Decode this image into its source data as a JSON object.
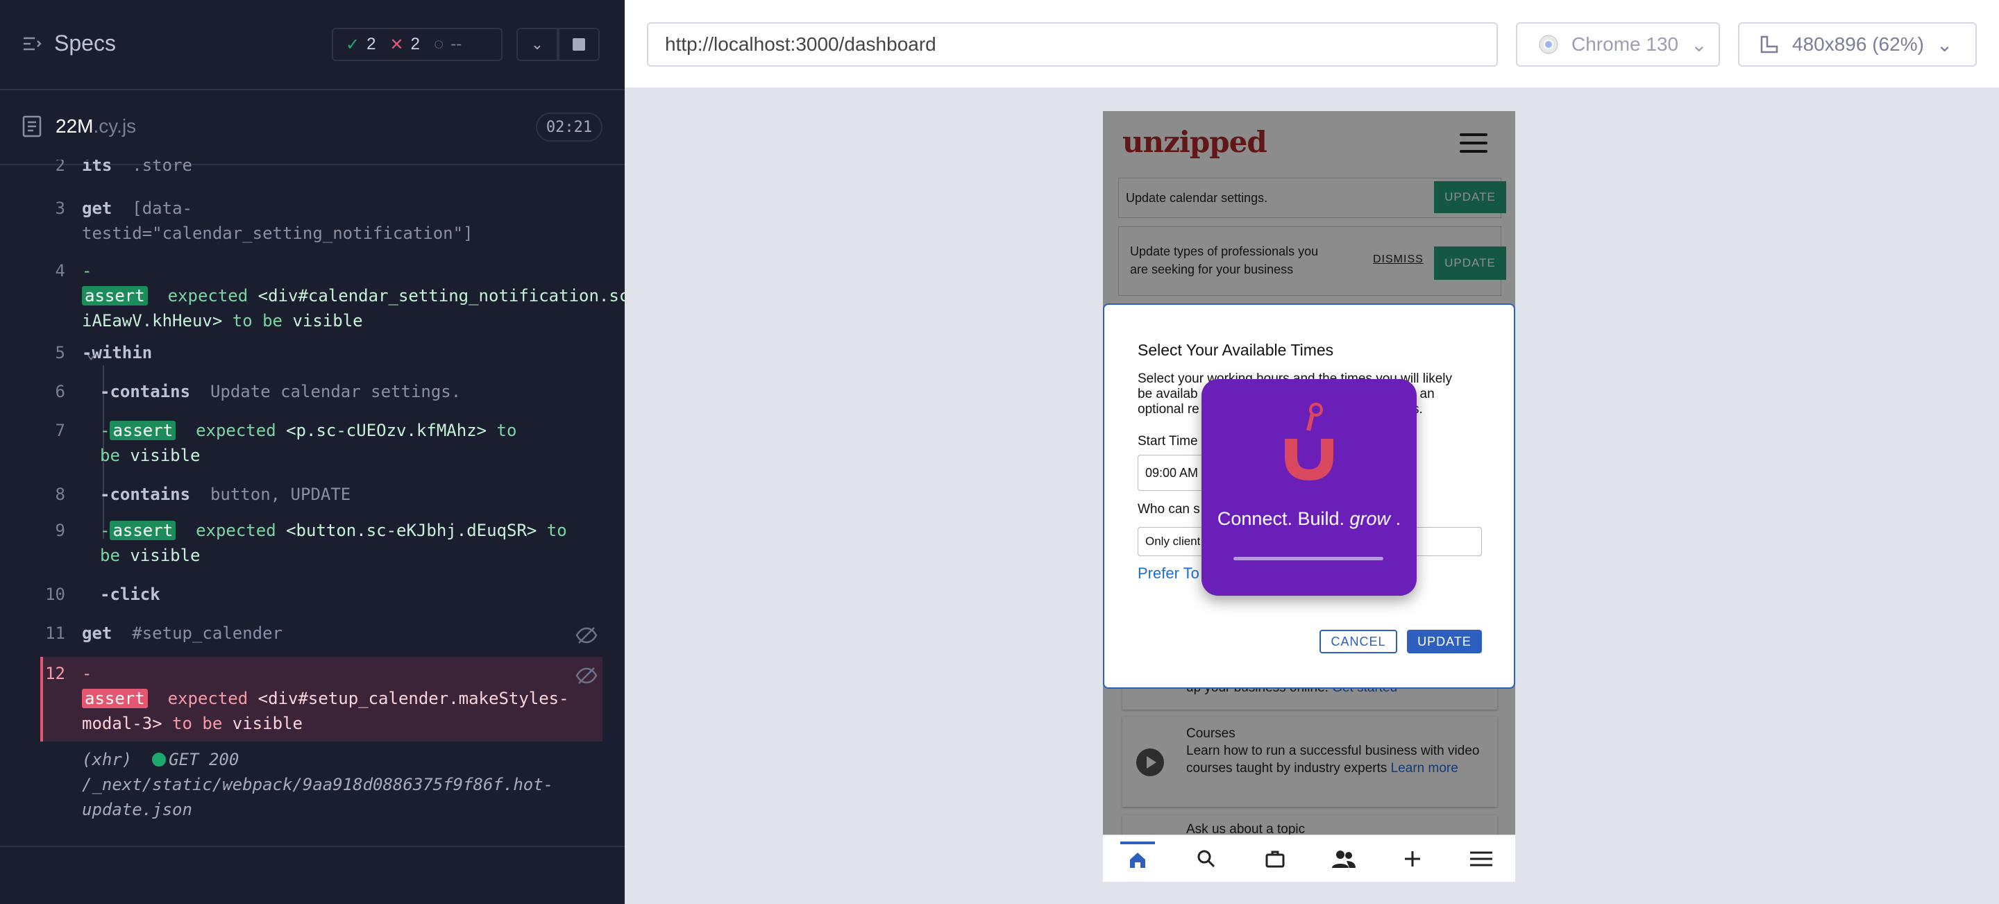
{
  "specs": {
    "title": "Specs",
    "passed": "2",
    "failed": "2",
    "pending": "--"
  },
  "file": {
    "name": "22M",
    "ext": ".cy.js",
    "duration": "02:21"
  },
  "commands": {
    "c2": {
      "num": "2",
      "name": "its",
      "arg": ".store"
    },
    "c3": {
      "num": "3",
      "name": "get",
      "arg": "[data-testid=\"calendar_setting_notification\"]"
    },
    "c4": {
      "num": "4",
      "dash": "-",
      "chip": "assert",
      "w1": "expected",
      "el": "<div#calendar_setting_notification.sc-iAEawV.khHeuv>",
      "w2": "to be",
      "w3": "visible"
    },
    "c5": {
      "num": "5",
      "name": "-within"
    },
    "c6": {
      "num": "6",
      "name": "-contains",
      "arg": "Update calendar settings."
    },
    "c7": {
      "num": "7",
      "dash": "-",
      "chip": "assert",
      "w1": "expected",
      "el": "<p.sc-cUEOzv.kfMAhz>",
      "w2": "to be",
      "w3": "visible"
    },
    "c8": {
      "num": "8",
      "name": "-contains",
      "arg": "button, UPDATE"
    },
    "c9": {
      "num": "9",
      "dash": "-",
      "chip": "assert",
      "w1": "expected",
      "el": "<button.sc-eKJbhj.dEuqSR>",
      "w2": "to be",
      "w3": "visible"
    },
    "c10": {
      "num": "10",
      "name": "-click"
    },
    "c11": {
      "num": "11",
      "name": "get",
      "arg": "#setup_calender"
    },
    "c12": {
      "num": "12",
      "dash": "-",
      "chip": "assert",
      "w1": "expected",
      "el": "<div#setup_calender.makeStyles-modal-3>",
      "w2": "to",
      "w3": "be",
      "w4": "visible"
    },
    "xhr": {
      "label": "(xhr)",
      "status": "GET 200",
      "path": "/_next/static/webpack/9aa918d0886375f9f86f.hot-update.json"
    }
  },
  "browser": {
    "url": "http://localhost:3000/dashboard",
    "name": "Chrome 130",
    "viewport": "480x896",
    "scale": "(62%)"
  },
  "app": {
    "logo": "unzipped",
    "card1": {
      "text": "Update calendar settings.",
      "button": "UPDATE"
    },
    "card2": {
      "text": "Update types of professionals you are seeking for your business",
      "dismiss": "DISMISS",
      "button": "UPDATE"
    },
    "course_top": {
      "text": "up your business online.",
      "link": "Get started"
    },
    "courses": {
      "title": "Courses",
      "text": "Learn how to run a successful business with video courses taught by industry experts",
      "link": "Learn more"
    },
    "ask": {
      "title": "Ask us about a topic"
    }
  },
  "modal": {
    "title": "Select Your Available Times",
    "desc": "Select your working hours and the times you will likely be available. You'll receive an optional reminder ... receive an optional re... s.",
    "desc_line1": "Select your working hours and the times you will likely",
    "desc_line2": "be availab",
    "desc_line2b": "receive an",
    "desc_line3": "optional re",
    "desc_line3b": "s.",
    "start_label": "Start Time",
    "start_value": "09:00 AM",
    "who_label": "Who can s",
    "who_value": "Only client",
    "prefer": "Prefer To",
    "cancel": "CANCEL",
    "update": "UPDATE"
  },
  "splash": {
    "text": "Connect. Build.",
    "text_em": "grow",
    "text_end": "."
  }
}
